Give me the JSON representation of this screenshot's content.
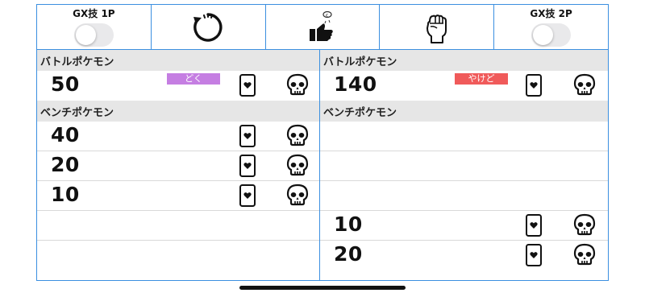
{
  "toolbar": {
    "gx_1p_label": "GX技 1P",
    "gx_2p_label": "GX技 2P",
    "icons": [
      "toggle-off",
      "reset-icon",
      "coin-flip-icon",
      "fist-icon",
      "toggle-off"
    ]
  },
  "left": {
    "battle_header": "バトルポケモン",
    "battle_hp": "50",
    "battle_status": "どく",
    "battle_status_color": "#c57ee2",
    "bench_header": "ベンチポケモン",
    "bench": [
      "40",
      "20",
      "10",
      "",
      ""
    ]
  },
  "right": {
    "battle_header": "バトルポケモン",
    "battle_hp": "140",
    "battle_status": "やけど",
    "battle_status_color": "#f05a5a",
    "bench_header": "ベンチポケモン",
    "bench": [
      "",
      "",
      "",
      "10",
      "20"
    ]
  }
}
